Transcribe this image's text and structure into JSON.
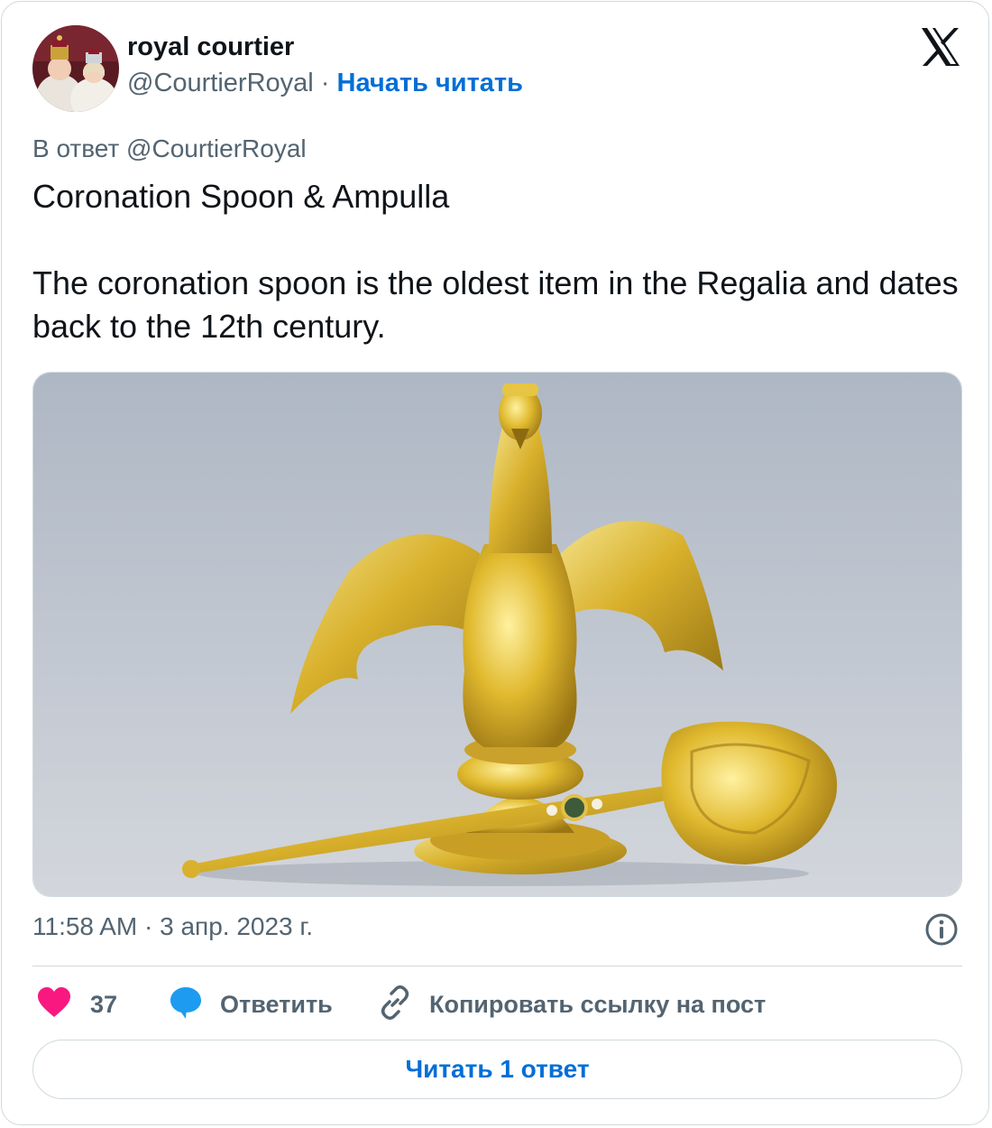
{
  "author": {
    "name": "royal courtier",
    "handle": "@CourtierRoyal",
    "separator": "·",
    "follow_label": "Начать читать"
  },
  "reply_to": "В ответ @CourtierRoyal",
  "tweet": {
    "title_line": "Coronation Spoon & Ampulla",
    "body": "The coronation spoon is the oldest item in the Regalia and dates back to the 12th century."
  },
  "media": {
    "alt": "Golden eagle-shaped Ampulla and the Coronation Spoon"
  },
  "timestamp": "11:58 AM · 3 апр. 2023 г.",
  "actions": {
    "like_count": "37",
    "reply_label": "Ответить",
    "copy_link_label": "Копировать ссылку на пост"
  },
  "read_replies_label": "Читать 1 ответ",
  "icons": {
    "platform": "x-logo-icon",
    "like": "heart-icon",
    "reply": "speech-bubble-icon",
    "copy": "link-icon",
    "info": "info-icon"
  },
  "colors": {
    "link": "#006fd6",
    "secondary_text": "#536471",
    "like": "#f91880",
    "reply": "#1d9bf0",
    "border": "#cfd9de"
  }
}
